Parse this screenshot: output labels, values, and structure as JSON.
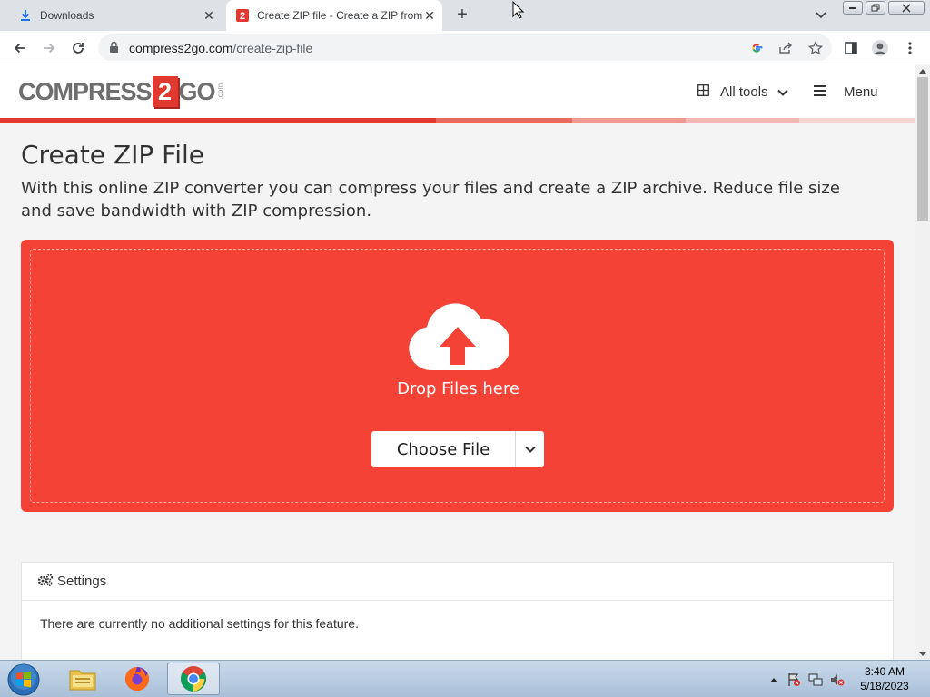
{
  "browser": {
    "tabs": [
      {
        "title": "Downloads",
        "active": false
      },
      {
        "title": "Create ZIP file - Create a ZIP from",
        "active": true
      }
    ],
    "url_host": "compress2go.com",
    "url_path": "/create-zip-file"
  },
  "site": {
    "logo": {
      "part1": "COMPRESS",
      "digit": "2",
      "part2": "GO",
      "suffix": ".com"
    },
    "nav": {
      "all_tools": "All tools",
      "menu": "Menu"
    }
  },
  "page": {
    "title": "Create ZIP File",
    "description": "With this online ZIP converter you can compress your files and create a ZIP archive. Reduce file size and save bandwidth with ZIP compression.",
    "upload": {
      "drop_text": "Drop Files here",
      "choose_file": "Choose File"
    },
    "settings": {
      "heading": "Settings",
      "body": "There are currently no additional settings for this feature."
    }
  },
  "taskbar": {
    "clock_time": "3:40 AM",
    "clock_date": "5/18/2023"
  },
  "colors": {
    "accent": "#f44336",
    "brand_red": "#e1392f"
  }
}
